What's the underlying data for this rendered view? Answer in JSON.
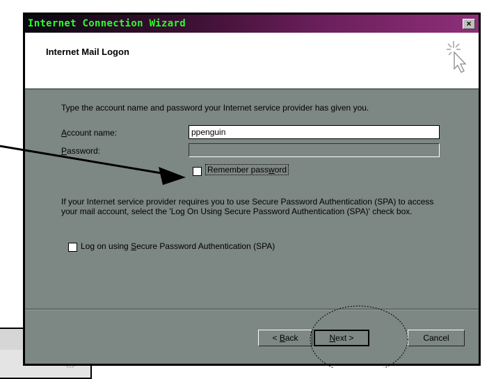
{
  "window": {
    "title": "Internet Connection Wizard",
    "close_label": "×"
  },
  "page_title": "Internet Mail Logon",
  "instruction": "Type the account name and password your Internet service provider has given you.",
  "account_name": {
    "label_prefix": "",
    "label_hotkey": "A",
    "label_rest": "ccount name:",
    "value": "ppenguin"
  },
  "password": {
    "label_prefix": "",
    "label_hotkey": "P",
    "label_rest": "assword:",
    "value": ""
  },
  "remember_password": {
    "label_prefix": "Remember pass",
    "label_hotkey": "w",
    "label_rest": "ord",
    "checked": false
  },
  "spa_description": "If your Internet service provider requires you to use Secure Password Authentication (SPA) to access your mail account, select the 'Log On Using Secure Password Authentication (SPA)' check box.",
  "spa_checkbox": {
    "label_prefix": "Log on using ",
    "label_hotkey": "S",
    "label_rest": "ecure Password Authentication (SPA)",
    "checked": false
  },
  "buttons": {
    "back": {
      "prefix": "< ",
      "hotkey": "B",
      "rest": "ack"
    },
    "next": {
      "prefix": "",
      "hotkey": "N",
      "rest": "ext >"
    },
    "cancel": "Cancel"
  },
  "background_window": {
    "close_label": "×"
  },
  "colors": {
    "title_text": "#2bff2b",
    "dialog_body": "#7d8784",
    "titlebar_dark": "#0a0810",
    "titlebar_light": "#8e2f7a"
  },
  "icons": [
    "wizard-cursor-icon",
    "close-icon",
    "pointer-arrow",
    "highlight-circle"
  ]
}
